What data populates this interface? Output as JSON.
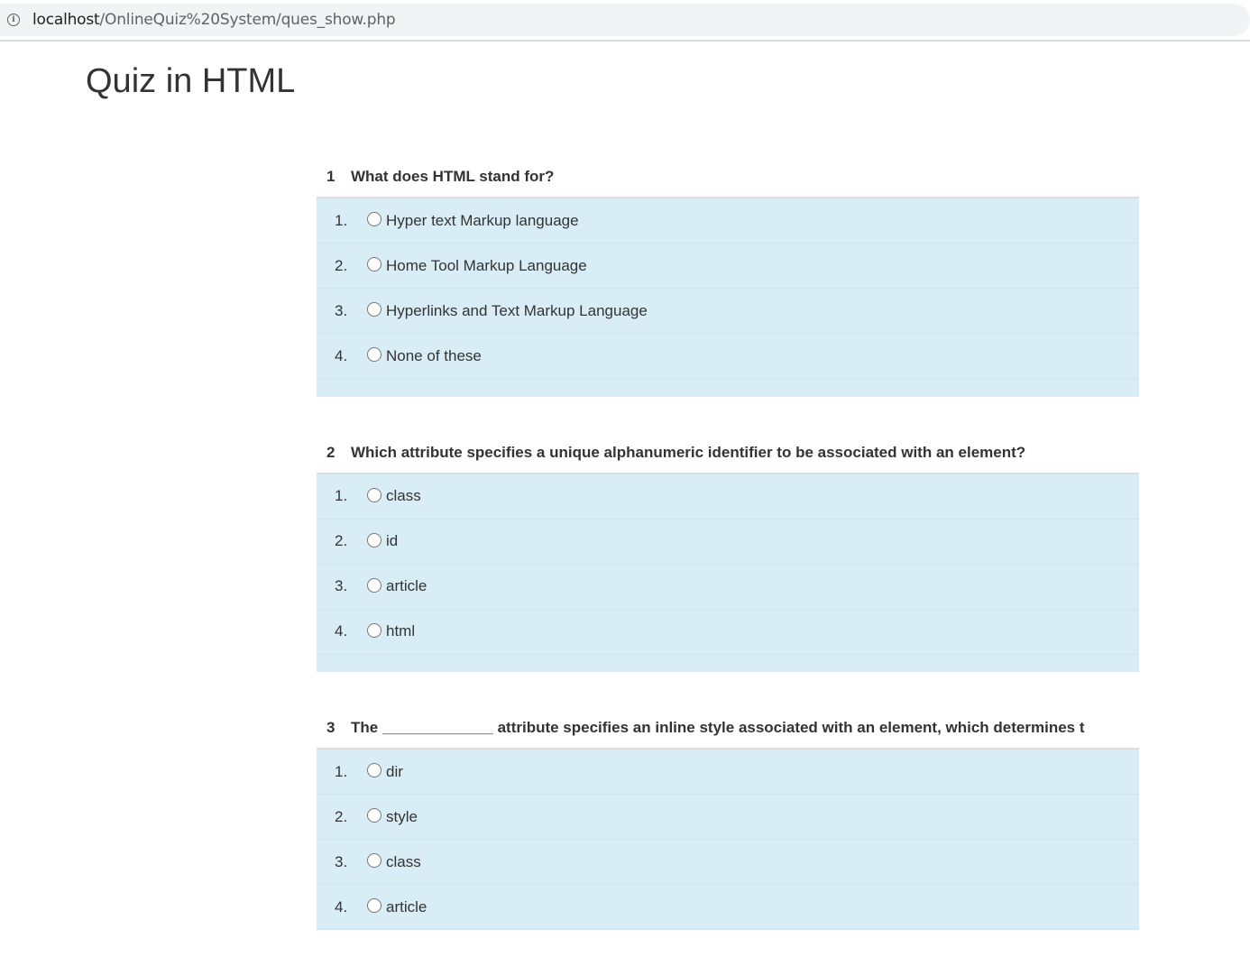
{
  "browser": {
    "url_host": "localhost",
    "url_path": "/OnlineQuiz%20System/ques_show.php",
    "info_icon": "info-icon"
  },
  "page": {
    "title": "Quiz in HTML"
  },
  "questions": [
    {
      "number": "1",
      "text": "What does HTML stand for?",
      "options": [
        {
          "num": "1.",
          "label": "Hyper text Markup language"
        },
        {
          "num": "2.",
          "label": "Home Tool Markup Language"
        },
        {
          "num": "3.",
          "label": "Hyperlinks and Text Markup Language"
        },
        {
          "num": "4.",
          "label": "None of these"
        }
      ]
    },
    {
      "number": "2",
      "text": "Which attribute specifies a unique alphanumeric identifier to be associated with an element?",
      "options": [
        {
          "num": "1.",
          "label": "class"
        },
        {
          "num": "2.",
          "label": "id"
        },
        {
          "num": "3.",
          "label": "article"
        },
        {
          "num": "4.",
          "label": "html"
        }
      ]
    },
    {
      "number": "3",
      "text": "The _____________ attribute specifies an inline style associated with an element, which determines t",
      "options": [
        {
          "num": "1.",
          "label": "dir"
        },
        {
          "num": "2.",
          "label": "style"
        },
        {
          "num": "3.",
          "label": "class"
        },
        {
          "num": "4.",
          "label": "article"
        }
      ]
    }
  ],
  "colors": {
    "option_row_bg": "#d9edf7",
    "text": "#333333",
    "address_bar_bg": "#f1f3f4"
  }
}
